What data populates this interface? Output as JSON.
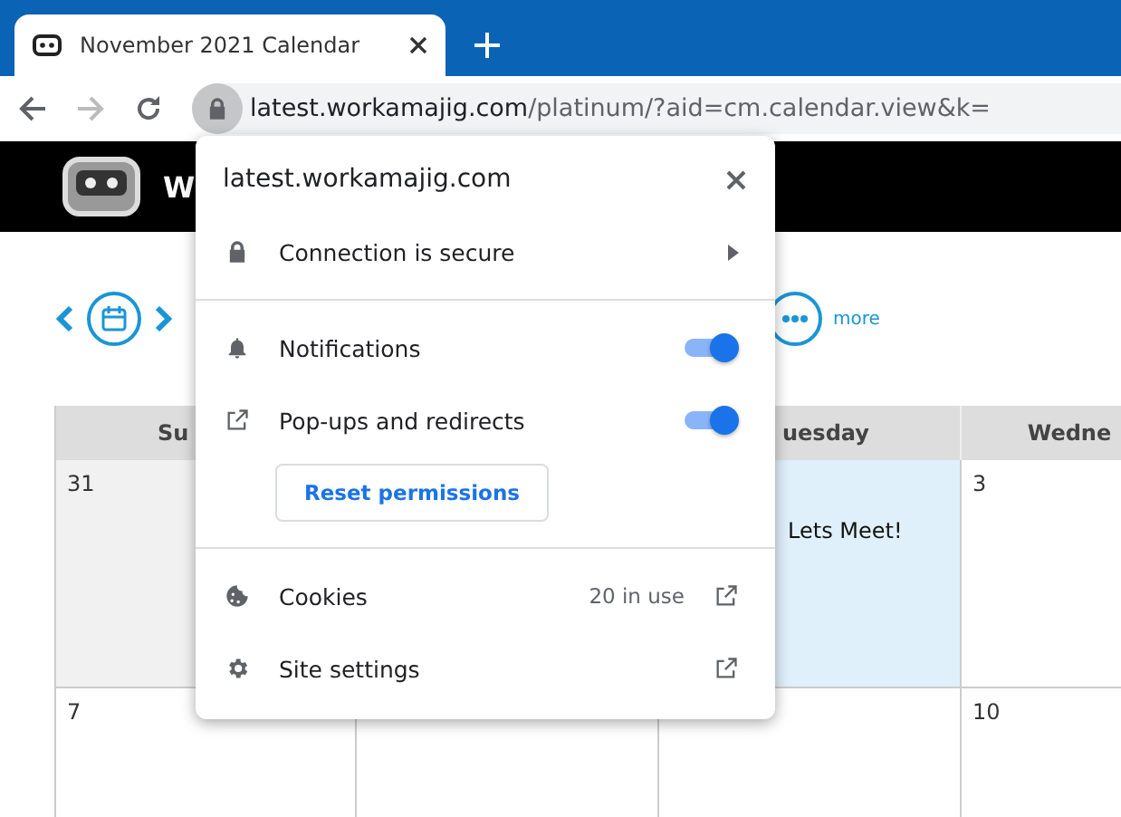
{
  "browser": {
    "tab": {
      "title": "November 2021 Calendar"
    },
    "url": {
      "host": "latest.workamajig.com",
      "path": "/platinum/?aid=cm.calendar.view&k="
    }
  },
  "app_header": {
    "title": "W"
  },
  "calendar_toolbar": {
    "more_label": "more"
  },
  "calendar": {
    "headers": [
      "Su",
      "uesday",
      "Wedne"
    ],
    "rows": [
      {
        "cells": [
          {
            "day": "31",
            "kind": "other_month"
          },
          {
            "kind": "hidden"
          },
          {
            "kind": "today",
            "event": "Lets Meet!"
          },
          {
            "day": "3",
            "kind": "normal"
          }
        ]
      },
      {
        "cells": [
          {
            "day": "7",
            "kind": "normal"
          },
          {
            "kind": "normal"
          },
          {
            "kind": "normal"
          },
          {
            "day": "10",
            "kind": "normal"
          }
        ]
      }
    ]
  },
  "site_info_popup": {
    "title": "latest.workamajig.com",
    "connection": "Connection is secure",
    "permissions": [
      {
        "label": "Notifications",
        "on": true
      },
      {
        "label": "Pop-ups and redirects",
        "on": true
      }
    ],
    "reset_button": "Reset permissions",
    "links": [
      {
        "label": "Cookies",
        "detail": "20 in use",
        "kind": "cookies"
      },
      {
        "label": "Site settings",
        "kind": "settings"
      }
    ]
  }
}
